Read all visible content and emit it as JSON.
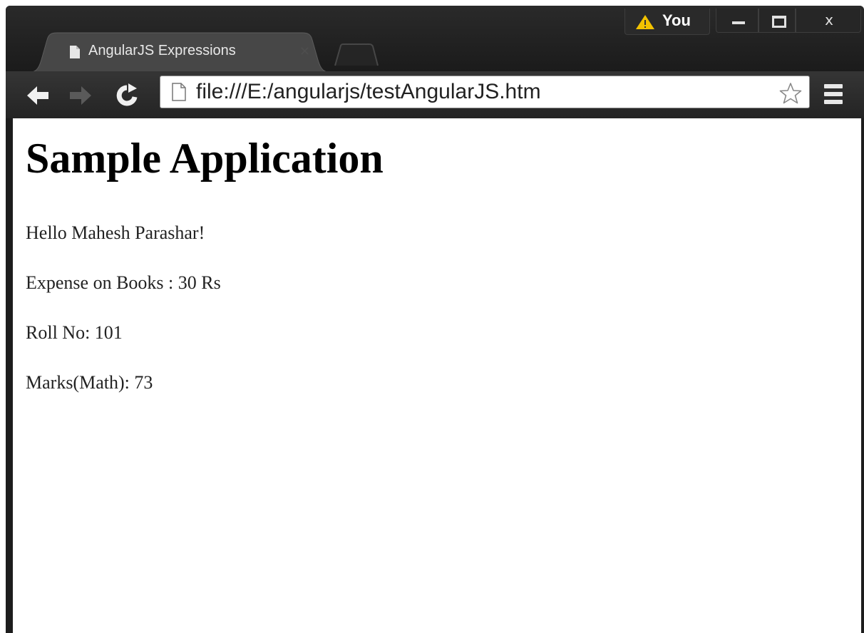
{
  "browser": {
    "tab": {
      "title": "AngularJS Expressions"
    },
    "profile": {
      "label": "You"
    },
    "window_controls": {
      "close_label": "x"
    },
    "address_bar": {
      "url": "file:///E:/angularjs/testAngularJS.htm"
    },
    "icons": [
      "page-icon",
      "close-icon",
      "warning-icon",
      "minimize-icon",
      "maximize-icon",
      "back-icon",
      "forward-icon",
      "reload-icon",
      "star-icon",
      "menu-icon"
    ],
    "colors": {
      "chrome_dark": "#1d1d1d",
      "warning": "#f2c200",
      "tab_active": "#474747"
    }
  },
  "page": {
    "heading": "Sample Application",
    "lines": [
      "Hello Mahesh Parashar!",
      "Expense on Books : 30 Rs",
      "Roll No: 101",
      "Marks(Math): 73"
    ]
  }
}
